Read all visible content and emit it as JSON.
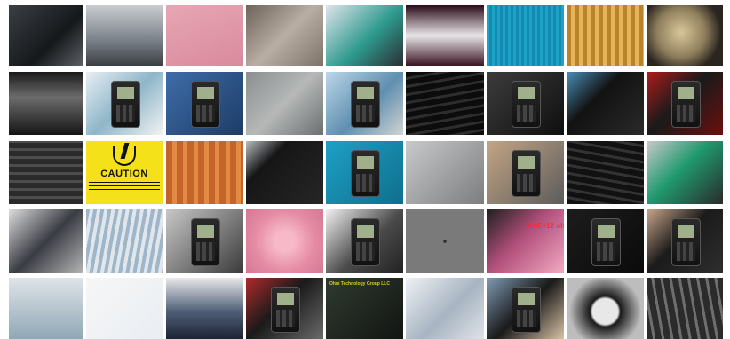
{
  "gallery": {
    "rows": 5,
    "cols": 9,
    "thumbnails": [
      {
        "label": "",
        "theme": "dark-machine"
      },
      {
        "label": "",
        "theme": "lab-bench"
      },
      {
        "label": "",
        "theme": "pink-foam"
      },
      {
        "label": "",
        "theme": "gray-tray"
      },
      {
        "label": "",
        "theme": "blue-cables"
      },
      {
        "label": "",
        "theme": "white-tub"
      },
      {
        "label": "",
        "theme": "blue-grid"
      },
      {
        "label": "",
        "theme": "amber-tubes"
      },
      {
        "label": "",
        "theme": "reel"
      },
      {
        "label": "",
        "theme": "dark-cylinder"
      },
      {
        "label": "",
        "theme": "meter-tubes"
      },
      {
        "label": "",
        "theme": "meter-probes"
      },
      {
        "label": "",
        "theme": "gray-panel"
      },
      {
        "label": "",
        "theme": "meter-map"
      },
      {
        "label": "",
        "theme": "black-belt"
      },
      {
        "label": "",
        "theme": "black-meter"
      },
      {
        "label": "",
        "theme": "black-case"
      },
      {
        "label": "",
        "theme": "red-case"
      },
      {
        "label": "",
        "theme": "rack"
      },
      {
        "label": "CAUTION",
        "theme": "caution-sign"
      },
      {
        "label": "",
        "theme": "amber-film"
      },
      {
        "label": "",
        "theme": "black-box"
      },
      {
        "label": "",
        "theme": "meter-blue"
      },
      {
        "label": "",
        "theme": "gray-probe"
      },
      {
        "label": "",
        "theme": "meter-hand"
      },
      {
        "label": "",
        "theme": "black-belt2"
      },
      {
        "label": "",
        "theme": "green-tray"
      },
      {
        "label": "",
        "theme": "bag-pile"
      },
      {
        "label": "",
        "theme": "tubes-blue"
      },
      {
        "label": "",
        "theme": "meter-gray"
      },
      {
        "label": "",
        "theme": "pink-peanuts"
      },
      {
        "label": "",
        "theme": "glove-meter"
      },
      {
        "label": "",
        "theme": "perf-sheet"
      },
      {
        "label": "2.6E+12 ohms",
        "theme": "probe-pink"
      },
      {
        "label": "",
        "theme": "meter-dark"
      },
      {
        "label": "",
        "theme": "meter-grid"
      },
      {
        "label": "",
        "theme": "black-post"
      },
      {
        "label": "",
        "theme": "humidity-card"
      },
      {
        "label": "",
        "theme": "bottle"
      },
      {
        "label": "",
        "theme": "meter-red"
      },
      {
        "label": "Ohm Technology Group LLC",
        "theme": "dark-mat"
      },
      {
        "label": "",
        "theme": "bag-clear"
      },
      {
        "label": "",
        "theme": "meter-hand2"
      },
      {
        "label": "",
        "theme": "disk"
      },
      {
        "label": "",
        "theme": "hanging-sheets"
      },
      {
        "label": "",
        "theme": "blue-mat"
      }
    ]
  },
  "colors": {
    "background": "#ffffff",
    "caution_yellow": "#f4e11a",
    "annotation_red": "#ff2a2a",
    "annotation_yellow": "#d8d020"
  }
}
